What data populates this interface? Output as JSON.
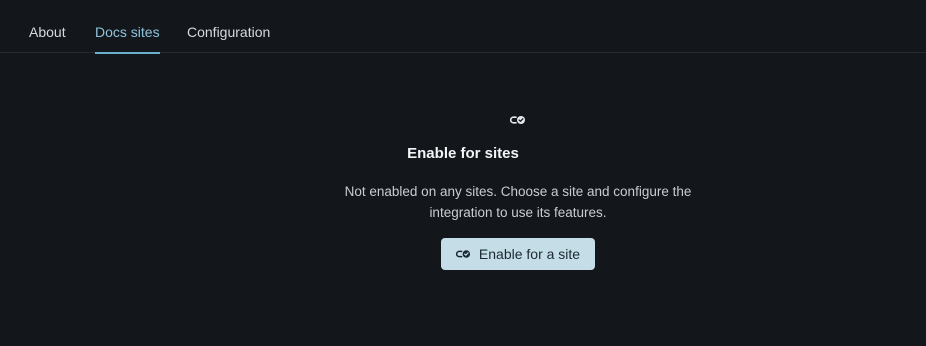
{
  "tabs": [
    {
      "label": "About"
    },
    {
      "label": "Docs sites",
      "active": true
    },
    {
      "label": "Configuration"
    }
  ],
  "empty_state": {
    "icon": "link-check-icon",
    "title": "Enable for sites",
    "description_line1": "Not enabled on any sites. Choose a site and configure the",
    "description_line2": "integration to use its features.",
    "button_label": "Enable for a site",
    "button_icon": "link-check-icon"
  },
  "colors": {
    "background": "#13171b",
    "accent": "#6aaed0",
    "button_bg": "#c5dde7"
  }
}
